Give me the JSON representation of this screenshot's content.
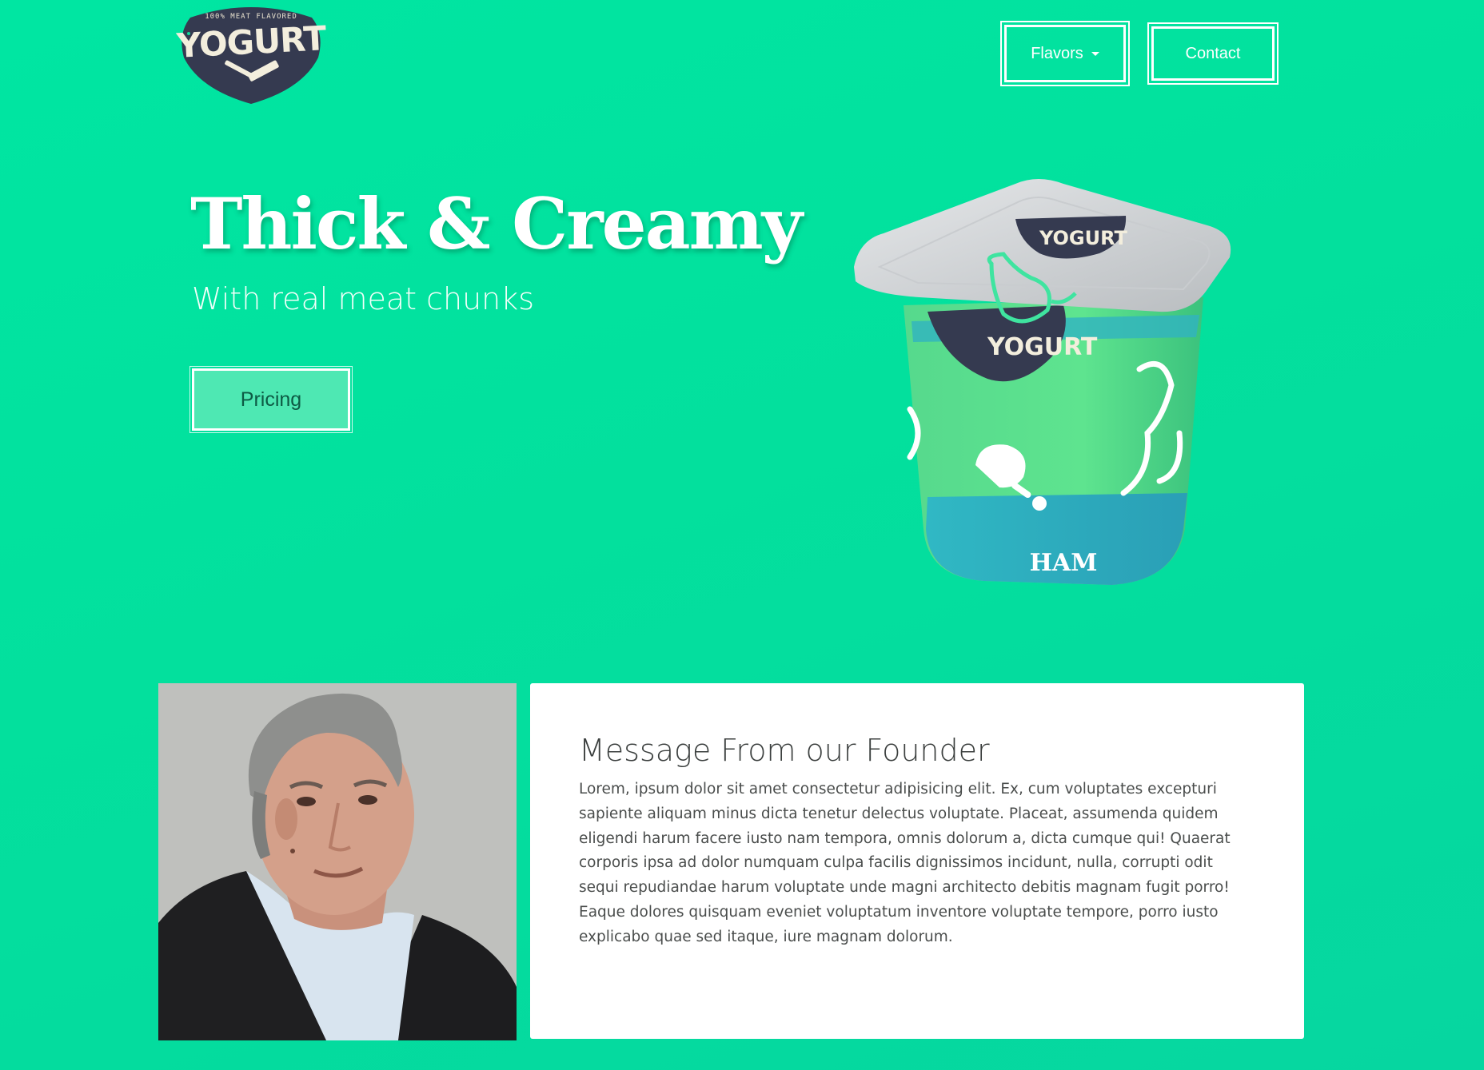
{
  "logo": {
    "tagline": "100% meat flavored",
    "brand": "YOGURT"
  },
  "nav": {
    "flavors_label": "Flavors",
    "contact_label": "Contact"
  },
  "hero": {
    "title": "Thick & Creamy",
    "subtitle": "With real meat chunks",
    "pricing_label": "Pricing"
  },
  "product": {
    "lid_brand": "YOGURT",
    "cup_brand": "YOGURT",
    "flavor": "HAM"
  },
  "founder": {
    "title": "Message From our Founder",
    "body": "Lorem, ipsum dolor sit amet consectetur adipisicing elit. Ex, cum voluptates excepturi sapiente aliquam minus dicta tenetur delectus voluptate. Placeat, assumenda quidem eligendi harum facere iusto nam tempora, omnis dolorum a, dicta cumque qui! Quaerat corporis ipsa ad dolor numquam culpa facilis dignissimos incidunt, nulla, corrupti odit sequi repudiandae harum voluptate unde magni architecto debitis magnam fugit porro! Eaque dolores quisquam eveniet voluptatum inventore voluptate tempore, porro iusto explicabo quae sed itaque, iure magnam dolorum."
  },
  "colors": {
    "background": "#00e6a2",
    "logo_badge": "#353a50",
    "card": "#ffffff",
    "pricing_fill": "#4ee8b3"
  }
}
